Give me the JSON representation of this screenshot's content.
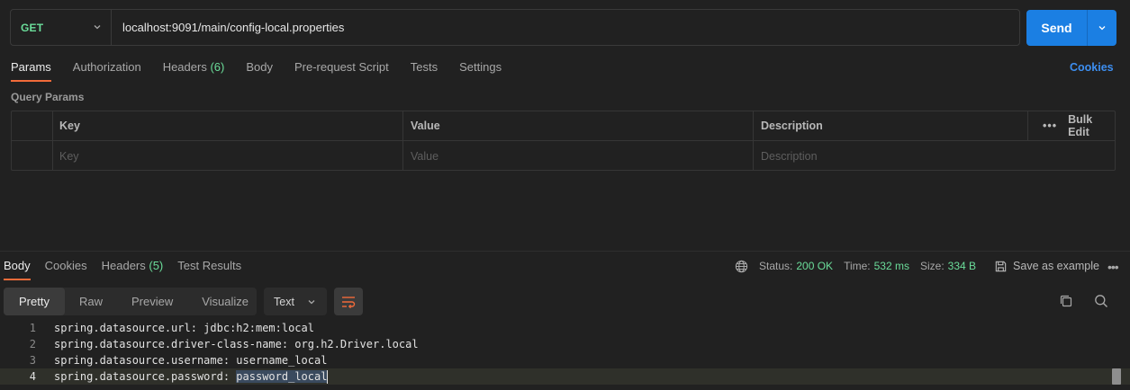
{
  "request": {
    "method": "GET",
    "url": "localhost:9091/main/config-local.properties",
    "send_label": "Send"
  },
  "request_tabs": [
    {
      "label": "Params",
      "active": true
    },
    {
      "label": "Authorization"
    },
    {
      "label": "Headers",
      "count": "(6)"
    },
    {
      "label": "Body"
    },
    {
      "label": "Pre-request Script"
    },
    {
      "label": "Tests"
    },
    {
      "label": "Settings"
    }
  ],
  "cookies_link": "Cookies",
  "query_params": {
    "title": "Query Params",
    "columns": {
      "key": "Key",
      "value": "Value",
      "description": "Description"
    },
    "bulk_edit": "Bulk Edit",
    "placeholders": {
      "key": "Key",
      "value": "Value",
      "description": "Description"
    }
  },
  "response_tabs": [
    {
      "label": "Body",
      "active": true
    },
    {
      "label": "Cookies"
    },
    {
      "label": "Headers",
      "count": "(5)"
    },
    {
      "label": "Test Results"
    }
  ],
  "status": {
    "status_label": "Status:",
    "status_value": "200 OK",
    "time_label": "Time:",
    "time_value": "532 ms",
    "size_label": "Size:",
    "size_value": "334 B",
    "save_label": "Save as example"
  },
  "view_modes": [
    {
      "label": "Pretty",
      "active": true
    },
    {
      "label": "Raw"
    },
    {
      "label": "Preview"
    },
    {
      "label": "Visualize"
    }
  ],
  "format": "Text",
  "code_lines": [
    {
      "n": "1",
      "text": "spring.datasource.url: jdbc:h2:mem:local"
    },
    {
      "n": "2",
      "text": "spring.datasource.driver-class-name: org.h2.Driver.local"
    },
    {
      "n": "3",
      "text": "spring.datasource.username: username_local"
    },
    {
      "n": "4",
      "text_before": "spring.datasource.password: ",
      "text_selected": "password_local"
    }
  ],
  "colors": {
    "accent_orange": "#f26b3a",
    "send_blue": "#1b7fe3",
    "success_green": "#6bdd9a",
    "link_blue": "#3d8ef0"
  }
}
